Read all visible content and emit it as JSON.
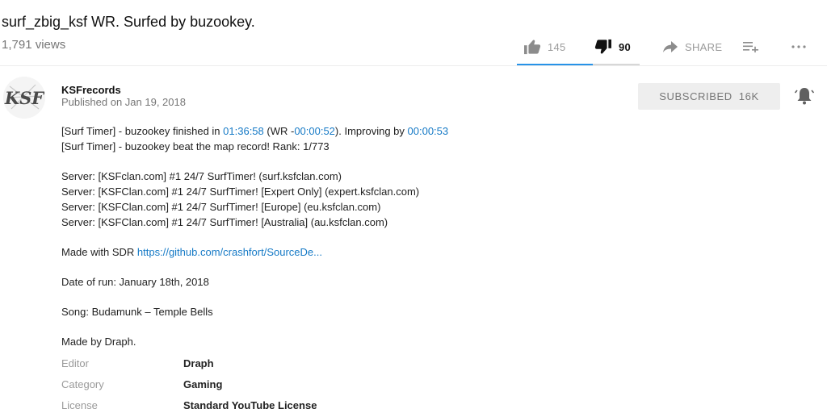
{
  "video": {
    "title": "surf_zbig_ksf WR. Surfed by buzookey.",
    "views": "1,791 views"
  },
  "actions": {
    "likes": "145",
    "dislikes": "90",
    "share_label": "SHARE",
    "icons": [
      "thumbs-up-icon",
      "thumbs-down-icon",
      "share-arrow-icon",
      "add-to-playlist-icon",
      "more-dots-icon"
    ]
  },
  "sentiment": {
    "like_ratio": 0.617
  },
  "channel": {
    "name": "KSFrecords",
    "published": "Published on Jan 19, 2018",
    "avatar_text": "KSF",
    "subscribe_label": "SUBSCRIBED",
    "subscriber_count": "16K"
  },
  "description": {
    "line1": {
      "part1": "[Surf Timer] - buzookey finished in ",
      "time": "01:36:58",
      "part2": " (WR -",
      "wr_diff": "00:00:52",
      "part3": "). Improving by ",
      "improve": "00:00:53"
    },
    "line2": "[Surf Timer] - buzookey beat the map record! Rank: 1/773",
    "servers": [
      "Server: [KSFclan.com] #1 24/7 SurfTimer! (surf.ksfclan.com)",
      "Server: [KSFClan.com] #1 24/7 SurfTimer! [Expert Only] (expert.ksfclan.com)",
      "Server: [KSFClan.com] #1 24/7 SurfTimer! [Europe] (eu.ksfclan.com)",
      "Server: [KSFClan.com] #1 24/7 SurfTimer! [Australia] (au.ksfclan.com)"
    ],
    "made_with_prefix": "Made with SDR ",
    "made_with_link": "https://github.com/crashfort/SourceDe...",
    "date_of_run": "Date of run: January 18th, 2018",
    "song": "Song: Budamunk – Temple Bells",
    "made_by": "Made by Draph."
  },
  "metadata": {
    "editor": {
      "label": "Editor",
      "value": "Draph"
    },
    "category": {
      "label": "Category",
      "value": "Gaming"
    },
    "license": {
      "label": "License",
      "value": "Standard YouTube License"
    }
  },
  "colors": {
    "link": "#167ac6",
    "sentiment_bar": "#2793e8",
    "muted_text": "#767676",
    "subscribe_bg": "#eeeeee"
  }
}
